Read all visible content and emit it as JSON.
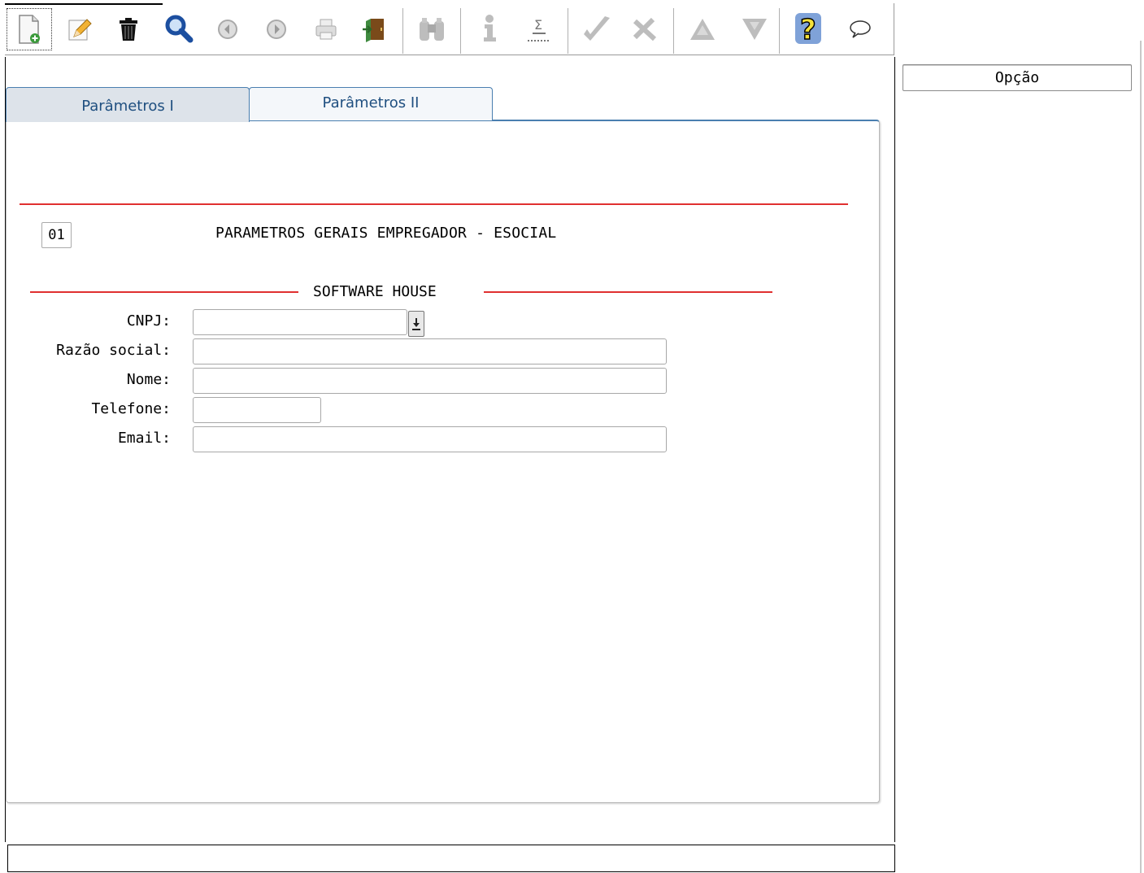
{
  "toolbar": {
    "buttons": [
      {
        "id": "new",
        "icon": "new-document-icon"
      },
      {
        "id": "edit",
        "icon": "pencil-icon"
      },
      {
        "id": "delete",
        "icon": "trash-icon"
      },
      {
        "id": "search",
        "icon": "magnifier-icon"
      },
      {
        "id": "previous",
        "icon": "arrow-left-circle-icon"
      },
      {
        "id": "next",
        "icon": "arrow-right-circle-icon"
      },
      {
        "id": "print",
        "icon": "printer-icon"
      },
      {
        "id": "exit",
        "icon": "exit-door-icon"
      },
      {
        "id": "binoculars",
        "icon": "binoculars-icon"
      },
      {
        "id": "info",
        "icon": "info-icon"
      },
      {
        "id": "sum",
        "icon": "sigma-icon"
      },
      {
        "id": "confirm",
        "icon": "check-icon"
      },
      {
        "id": "cancel",
        "icon": "cancel-x-icon"
      },
      {
        "id": "up",
        "icon": "triangle-up-icon"
      },
      {
        "id": "down",
        "icon": "triangle-down-icon"
      },
      {
        "id": "help",
        "icon": "help-question-icon"
      },
      {
        "id": "comment",
        "icon": "speech-bubble-icon"
      }
    ]
  },
  "option": {
    "label": "Opção"
  },
  "tabs": [
    {
      "label": "Parâmetros I"
    },
    {
      "label": "Parâmetros II"
    }
  ],
  "form": {
    "number": "01",
    "title": "PARAMETROS GERAIS EMPREGADOR - ESOCIAL",
    "section": "SOFTWARE HOUSE",
    "fields": {
      "cnpj": {
        "label": "CNPJ:",
        "value": ""
      },
      "razao_social": {
        "label": "Razão social:",
        "value": ""
      },
      "nome": {
        "label": "Nome:",
        "value": ""
      },
      "telefone": {
        "label": "Telefone:",
        "value": ""
      },
      "email": {
        "label": "Email:",
        "value": ""
      }
    }
  },
  "colors": {
    "accent": "#4a7fb0",
    "red_line": "#e03030"
  }
}
